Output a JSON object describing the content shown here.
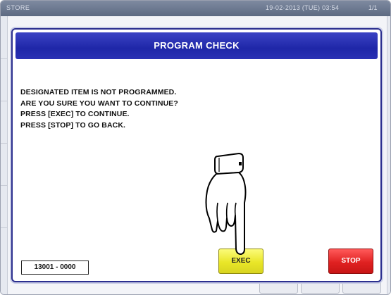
{
  "status_bar": {
    "store_label": "STORE",
    "datetime": "19-02-2013 (TUE) 03:54",
    "page": "1/1"
  },
  "dialog": {
    "title": "PROGRAM CHECK",
    "message_lines": [
      "DESIGNATED ITEM IS NOT PROGRAMMED.",
      "ARE YOU SURE YOU WANT TO CONTINUE?",
      "PRESS [EXEC] TO CONTINUE.",
      "PRESS [STOP] TO GO BACK."
    ],
    "code": "13001 - 0000",
    "exec_label": "EXEC",
    "stop_label": "STOP"
  },
  "colors": {
    "header_blue": "#1f27a8",
    "exec_yellow": "#e9e628",
    "stop_red": "#e02121"
  },
  "icons": {
    "pointer": "pointing-hand-icon"
  }
}
